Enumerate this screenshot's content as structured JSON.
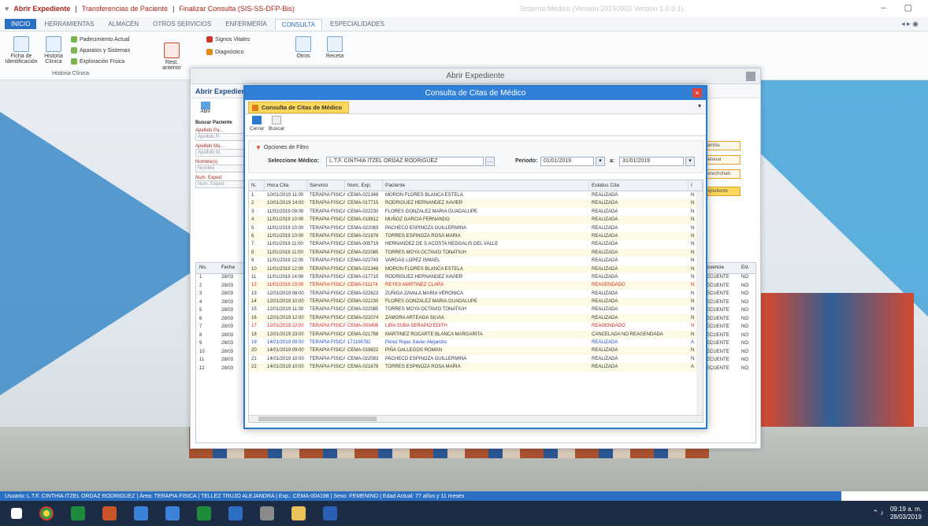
{
  "app": {
    "title_part1": "Abrir Expediente",
    "title_part2": "Transferencias de Paciente",
    "title_part3": "Finalizar Consulta (SIS-SS-DFP-Bis)",
    "version": "Sistema Médico (Versión 20190903 Versión 1.0.0.1)"
  },
  "menu": [
    {
      "label": "INICIO"
    },
    {
      "label": "HERRAMIENTAS"
    },
    {
      "label": "ALMACÉN"
    },
    {
      "label": "OTROS SERVICIOS"
    },
    {
      "label": "ENFERMERÍA"
    },
    {
      "label": "CONSULTA"
    },
    {
      "label": "ESPECIALIDADES"
    }
  ],
  "ribbon": {
    "ficha": "Ficha de Identificación",
    "historia": "Historia Clínica",
    "padecimiento": "Padecimiento Actual",
    "aparatos": "Aparatos y Sistemas",
    "exploracion": "Exploración Física",
    "historia_group": "Historia Clínica",
    "signos": "Signos Vitales",
    "diagnostico": "Diagnóstico",
    "resumen": "Rest. anterior",
    "otros": "Otros",
    "receta": "Receta"
  },
  "abrir": {
    "title": "Abrir Expediente",
    "subtab": "Abrir Expediente",
    "abrir_btn": "Abrir",
    "buscar_label": "Buscar Paciente",
    "apellido_paterno": "Apellido Pa...",
    "apellido_materno": "Apellido Ma...",
    "nombre": "Nombre(s)",
    "num_exp": "Num. Exped.",
    "ph_ap": "Apellido P.",
    "ph_am": "Apellido M.",
    "ph_nombre": "Nombre",
    "ph_exp": "Num. Exped.",
    "btn1": "Familia",
    "btn2": "General",
    "btn3": "Derechohab.",
    "btn4": "Expediente",
    "col_no": "No.",
    "col_fecha": "Fecha",
    "col_frecuencia": "Frecuencia",
    "col_est": "Est.",
    "rows": [
      {
        "n": "1",
        "f": "28/03",
        "r": "FRECUENTE",
        "e": "NO"
      },
      {
        "n": "2",
        "f": "28/03",
        "r": "FRECUENTE",
        "e": "NO"
      },
      {
        "n": "3",
        "f": "28/03",
        "r": "FRECUENTE",
        "e": "NO"
      },
      {
        "n": "4",
        "f": "28/03",
        "r": "FRECUENTE",
        "e": "NO"
      },
      {
        "n": "5",
        "f": "28/03",
        "r": "FRECUENTE",
        "e": "NO"
      },
      {
        "n": "6",
        "f": "28/03",
        "r": "FRECUENTE",
        "e": "NO"
      },
      {
        "n": "7",
        "f": "28/03",
        "r": "FRECUENTE",
        "e": "NO"
      },
      {
        "n": "8",
        "f": "28/03",
        "r": "FRECUENTE",
        "e": "NO"
      },
      {
        "n": "9",
        "f": "28/03",
        "r": "FRECUENTE",
        "e": "NO"
      },
      {
        "n": "10",
        "f": "28/03",
        "r": "FRECUENTE",
        "e": "NO"
      },
      {
        "n": "11",
        "f": "28/03",
        "r": "FRECUENTE",
        "e": "NO"
      },
      {
        "n": "12",
        "f": "28/03",
        "r": "FRECUENTE",
        "e": "NO"
      }
    ]
  },
  "consulta": {
    "title": "Consulta de Citas de Médico",
    "tab": "Consulta de Citas de Médico",
    "cerrar": "Cerrar",
    "buscar": "Buscar",
    "opciones": "Opciones de Filtro",
    "medico_label": "Seleccione Médico:",
    "medico_value": "L.T.F. CINTHIA ITZEL ORDAZ RODRIGUEZ",
    "periodo_label": "Periodo:",
    "fecha_ini": "01/01/2019",
    "a_label": "a:",
    "fecha_fin": "31/01/2019",
    "columns": {
      "n": "N.",
      "hora": "Hora Cita",
      "servicio": "Servicio",
      "exp": "Num. Exp.",
      "paciente": "Paciente",
      "estatus": "Estatus Cita",
      "x": "I"
    },
    "rows": [
      {
        "n": "1",
        "hora": "10/01/2019 11:00",
        "serv": "TERAPIA FISICA",
        "exp": "CEMA-021348",
        "pac": "MORON FLORES BLANCA ESTELA",
        "est": "REALIZADA",
        "x": "N",
        "t": ""
      },
      {
        "n": "2",
        "hora": "10/01/2019 14:00",
        "serv": "TERAPIA FISICA",
        "exp": "CEMA-017715",
        "pac": "RODRIGUEZ HERNANDEZ XAVIER",
        "est": "REALIZADA",
        "x": "N",
        "t": ""
      },
      {
        "n": "3",
        "hora": "11/01/2019 09:00",
        "serv": "TERAPIA FISICA",
        "exp": "CEMA-022230",
        "pac": "FLORES GONZALEZ MARIA GUADALUPE",
        "est": "REALIZADA",
        "x": "N",
        "t": ""
      },
      {
        "n": "4",
        "hora": "11/01/2019 10:00",
        "serv": "TERAPIA FISICA",
        "exp": "CEMA-019812",
        "pac": "MUÑOZ GARCIA FERNANDO",
        "est": "REALIZADA",
        "x": "N",
        "t": ""
      },
      {
        "n": "5",
        "hora": "11/01/2019 10:00",
        "serv": "TERAPIA FISICA",
        "exp": "CEMA-022083",
        "pac": "PACHECO ESPINOZA GUILLERMINA",
        "est": "REALIZADA",
        "x": "N",
        "t": ""
      },
      {
        "n": "6",
        "hora": "11/01/2019 10:00",
        "serv": "TERAPIA FISICA",
        "exp": "CEMA-021678",
        "pac": "TORRES ESPINOZA ROSA MARIA",
        "est": "REALIZADA",
        "x": "N",
        "t": ""
      },
      {
        "n": "7",
        "hora": "11/01/2019 11:00",
        "serv": "TERAPIA FISICA",
        "exp": "CEMA-005719",
        "pac": "HERNANDEZ DE S ACOSTA NEDGALIS DEL VALLE",
        "est": "REALIZADA",
        "x": "N",
        "t": ""
      },
      {
        "n": "8",
        "hora": "11/01/2019 11:00",
        "serv": "TERAPIA FISICA",
        "exp": "CEMA-022085",
        "pac": "TORRES MOYA OCTAVIO TONATIUH",
        "est": "REALIZADA",
        "x": "N",
        "t": ""
      },
      {
        "n": "9",
        "hora": "11/01/2019 12:00",
        "serv": "TERAPIA FISICA",
        "exp": "CEMA-022743",
        "pac": "VARGAS LOPEZ ISMAEL",
        "est": "REALIZADA",
        "x": "N",
        "t": ""
      },
      {
        "n": "10",
        "hora": "11/01/2019 12:00",
        "serv": "TERAPIA FISICA",
        "exp": "CEMA-021348",
        "pac": "MORON FLORES BLANCA ESTELA",
        "est": "REALIZADA",
        "x": "N",
        "t": ""
      },
      {
        "n": "11",
        "hora": "11/01/2019 14:00",
        "serv": "TERAPIA FISICA",
        "exp": "CEMA-017715",
        "pac": "RODRIGUEZ HERNANDEZ XAVIER",
        "est": "REALIZADA",
        "x": "N",
        "t": ""
      },
      {
        "n": "12",
        "hora": "11/01/2019 23:00",
        "serv": "TERAPIA FISICA",
        "exp": "CEMA-011174",
        "pac": "REYES MARTINEZ CLARA",
        "est": "REAGENDADO",
        "x": "N",
        "t": "red"
      },
      {
        "n": "13",
        "hora": "12/01/2019 08:00",
        "serv": "TERAPIA FISICA",
        "exp": "CEMA-022623",
        "pac": "ZUÑIGA ZAVALA MARIA VERONICA",
        "est": "REALIZADA",
        "x": "N",
        "t": ""
      },
      {
        "n": "14",
        "hora": "12/01/2019 10:00",
        "serv": "TERAPIA FISICA",
        "exp": "CEMA-022230",
        "pac": "FLORES GONZALEZ MARIA GUADALUPE",
        "est": "REALIZADA",
        "x": "N",
        "t": ""
      },
      {
        "n": "15",
        "hora": "12/01/2019 11:00",
        "serv": "TERAPIA FISICA",
        "exp": "CEMA-022085",
        "pac": "TORRES MOYA OCTAVIO TONATIUH",
        "est": "REALIZADA",
        "x": "N",
        "t": ""
      },
      {
        "n": "16",
        "hora": "12/01/2019 12:00",
        "serv": "TERAPIA FISICA",
        "exp": "CEMA-022074",
        "pac": "ZAMORA ARTEAGA SILVIA",
        "est": "REALIZADA",
        "x": "N",
        "t": ""
      },
      {
        "n": "17",
        "hora": "12/01/2019 22:00",
        "serv": "TERAPIA FISICA",
        "exp": "CEMA-003406",
        "pac": "LIRA SUBA SERAPIO EDITH",
        "est": "REAGENDADO",
        "x": "N",
        "t": "red"
      },
      {
        "n": "18",
        "hora": "12/01/2019 23:00",
        "serv": "TERAPIA FISICA",
        "exp": "CEMA-021788",
        "pac": "MARTINEZ ROCARTE BLANCA MARGARITA",
        "est": "CANCELADA NO REAGENDADA",
        "x": "N",
        "t": ""
      },
      {
        "n": "19",
        "hora": "14/01/2019 09:00",
        "serv": "TERAPIA FISICA",
        "exp": "171106782",
        "pac": "Pérez Rojas Xavier Alejandro",
        "est": "REALIZADA",
        "x": "A",
        "t": "blue"
      },
      {
        "n": "20",
        "hora": "14/01/2019 09:00",
        "serv": "TERAPIA FISICA",
        "exp": "CEMA-019822",
        "pac": "PIÑA GALLEGOS ROMAN",
        "est": "REALIZADA",
        "x": "N",
        "t": ""
      },
      {
        "n": "21",
        "hora": "14/01/2019 10:00",
        "serv": "TERAPIA FISICA",
        "exp": "CEMA-022083",
        "pac": "PACHECO ESPINOZA GUILLERMINA",
        "est": "REALIZADA",
        "x": "N",
        "t": ""
      },
      {
        "n": "22",
        "hora": "14/01/2019 10:00",
        "serv": "TERAPIA FISICA",
        "exp": "CEMA-021678",
        "pac": "TORRES ESPINOZA ROSA MARIA",
        "est": "REALIZADA",
        "x": "A",
        "t": ""
      }
    ]
  },
  "status": "Usuario: L.T.F. CINTHIA ITZEL ORDAZ RODRIGUEZ | Área: TERAPIA FISICA | TELLEZ TRUJO ALEJANDRA | Exp.: CEMA-004198 | Sexo: FEMENINO | Edad Actual: 77 años y 11 meses",
  "clock": {
    "time": "09:19 a. m.",
    "date": "28/03/2019"
  },
  "colors": {
    "accent": "#2b6fc2",
    "window_header": "#2f80d6",
    "tab_yellow": "#ffd75a",
    "reagendado": "#d9261c"
  }
}
